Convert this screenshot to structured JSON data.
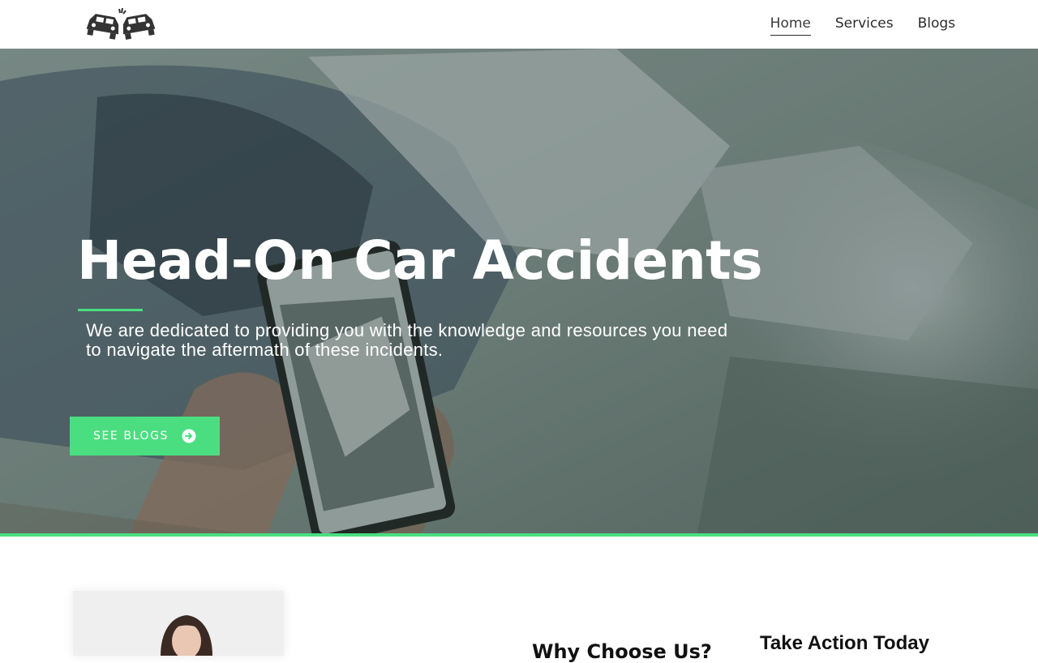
{
  "header": {
    "logo_icon": "car-crash-icon",
    "nav": [
      {
        "label": "Home",
        "active": true
      },
      {
        "label": "Services",
        "active": false
      },
      {
        "label": "Blogs",
        "active": false
      }
    ]
  },
  "hero": {
    "title": "Head-On Car Accidents",
    "subtitle": "We are dedicated to providing you with the knowledge and resources you need to navigate the aftermath of these incidents.",
    "cta_label": "SEE BLOGS",
    "cta_icon": "arrow-circle-right-icon"
  },
  "sections": {
    "heading_1": "Why Choose Us?",
    "heading_2": "Take Action Today"
  },
  "colors": {
    "accent": "#4ade80",
    "text_dark": "#2c2c2c"
  }
}
